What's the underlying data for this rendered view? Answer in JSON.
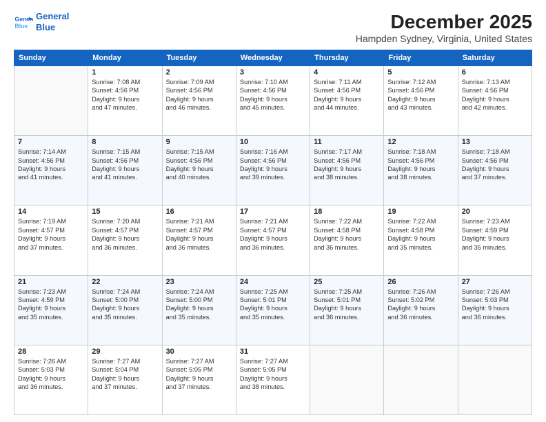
{
  "logo": {
    "line1": "General",
    "line2": "Blue"
  },
  "title": "December 2025",
  "subtitle": "Hampden Sydney, Virginia, United States",
  "days_of_week": [
    "Sunday",
    "Monday",
    "Tuesday",
    "Wednesday",
    "Thursday",
    "Friday",
    "Saturday"
  ],
  "weeks": [
    [
      {
        "day": "",
        "info": ""
      },
      {
        "day": "1",
        "info": "Sunrise: 7:08 AM\nSunset: 4:56 PM\nDaylight: 9 hours\nand 47 minutes."
      },
      {
        "day": "2",
        "info": "Sunrise: 7:09 AM\nSunset: 4:56 PM\nDaylight: 9 hours\nand 46 minutes."
      },
      {
        "day": "3",
        "info": "Sunrise: 7:10 AM\nSunset: 4:56 PM\nDaylight: 9 hours\nand 45 minutes."
      },
      {
        "day": "4",
        "info": "Sunrise: 7:11 AM\nSunset: 4:56 PM\nDaylight: 9 hours\nand 44 minutes."
      },
      {
        "day": "5",
        "info": "Sunrise: 7:12 AM\nSunset: 4:56 PM\nDaylight: 9 hours\nand 43 minutes."
      },
      {
        "day": "6",
        "info": "Sunrise: 7:13 AM\nSunset: 4:56 PM\nDaylight: 9 hours\nand 42 minutes."
      }
    ],
    [
      {
        "day": "7",
        "info": "Sunrise: 7:14 AM\nSunset: 4:56 PM\nDaylight: 9 hours\nand 41 minutes."
      },
      {
        "day": "8",
        "info": "Sunrise: 7:15 AM\nSunset: 4:56 PM\nDaylight: 9 hours\nand 41 minutes."
      },
      {
        "day": "9",
        "info": "Sunrise: 7:15 AM\nSunset: 4:56 PM\nDaylight: 9 hours\nand 40 minutes."
      },
      {
        "day": "10",
        "info": "Sunrise: 7:16 AM\nSunset: 4:56 PM\nDaylight: 9 hours\nand 39 minutes."
      },
      {
        "day": "11",
        "info": "Sunrise: 7:17 AM\nSunset: 4:56 PM\nDaylight: 9 hours\nand 38 minutes."
      },
      {
        "day": "12",
        "info": "Sunrise: 7:18 AM\nSunset: 4:56 PM\nDaylight: 9 hours\nand 38 minutes."
      },
      {
        "day": "13",
        "info": "Sunrise: 7:18 AM\nSunset: 4:56 PM\nDaylight: 9 hours\nand 37 minutes."
      }
    ],
    [
      {
        "day": "14",
        "info": "Sunrise: 7:19 AM\nSunset: 4:57 PM\nDaylight: 9 hours\nand 37 minutes."
      },
      {
        "day": "15",
        "info": "Sunrise: 7:20 AM\nSunset: 4:57 PM\nDaylight: 9 hours\nand 36 minutes."
      },
      {
        "day": "16",
        "info": "Sunrise: 7:21 AM\nSunset: 4:57 PM\nDaylight: 9 hours\nand 36 minutes."
      },
      {
        "day": "17",
        "info": "Sunrise: 7:21 AM\nSunset: 4:57 PM\nDaylight: 9 hours\nand 36 minutes."
      },
      {
        "day": "18",
        "info": "Sunrise: 7:22 AM\nSunset: 4:58 PM\nDaylight: 9 hours\nand 36 minutes."
      },
      {
        "day": "19",
        "info": "Sunrise: 7:22 AM\nSunset: 4:58 PM\nDaylight: 9 hours\nand 35 minutes."
      },
      {
        "day": "20",
        "info": "Sunrise: 7:23 AM\nSunset: 4:59 PM\nDaylight: 9 hours\nand 35 minutes."
      }
    ],
    [
      {
        "day": "21",
        "info": "Sunrise: 7:23 AM\nSunset: 4:59 PM\nDaylight: 9 hours\nand 35 minutes."
      },
      {
        "day": "22",
        "info": "Sunrise: 7:24 AM\nSunset: 5:00 PM\nDaylight: 9 hours\nand 35 minutes."
      },
      {
        "day": "23",
        "info": "Sunrise: 7:24 AM\nSunset: 5:00 PM\nDaylight: 9 hours\nand 35 minutes."
      },
      {
        "day": "24",
        "info": "Sunrise: 7:25 AM\nSunset: 5:01 PM\nDaylight: 9 hours\nand 35 minutes."
      },
      {
        "day": "25",
        "info": "Sunrise: 7:25 AM\nSunset: 5:01 PM\nDaylight: 9 hours\nand 36 minutes."
      },
      {
        "day": "26",
        "info": "Sunrise: 7:26 AM\nSunset: 5:02 PM\nDaylight: 9 hours\nand 36 minutes."
      },
      {
        "day": "27",
        "info": "Sunrise: 7:26 AM\nSunset: 5:03 PM\nDaylight: 9 hours\nand 36 minutes."
      }
    ],
    [
      {
        "day": "28",
        "info": "Sunrise: 7:26 AM\nSunset: 5:03 PM\nDaylight: 9 hours\nand 36 minutes."
      },
      {
        "day": "29",
        "info": "Sunrise: 7:27 AM\nSunset: 5:04 PM\nDaylight: 9 hours\nand 37 minutes."
      },
      {
        "day": "30",
        "info": "Sunrise: 7:27 AM\nSunset: 5:05 PM\nDaylight: 9 hours\nand 37 minutes."
      },
      {
        "day": "31",
        "info": "Sunrise: 7:27 AM\nSunset: 5:05 PM\nDaylight: 9 hours\nand 38 minutes."
      },
      {
        "day": "",
        "info": ""
      },
      {
        "day": "",
        "info": ""
      },
      {
        "day": "",
        "info": ""
      }
    ]
  ]
}
